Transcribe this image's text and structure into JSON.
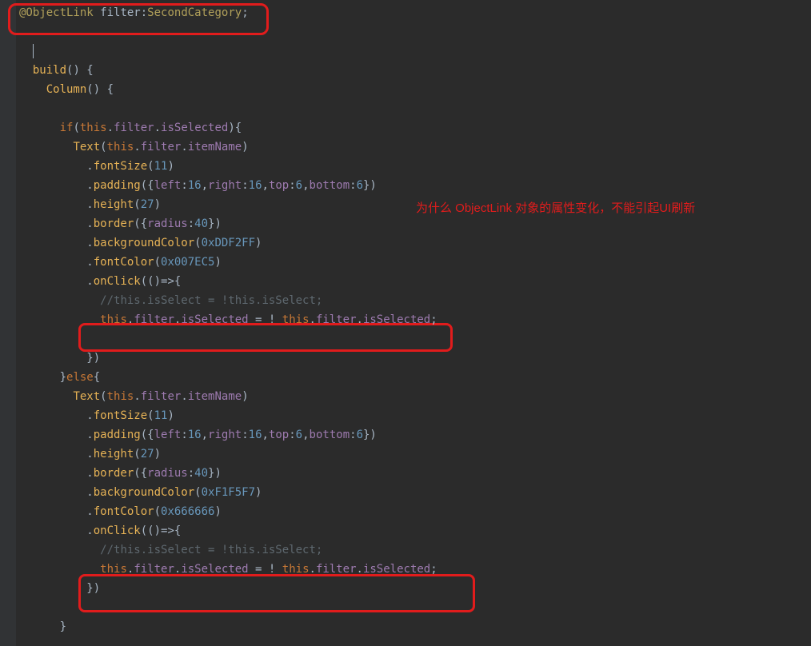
{
  "colors": {
    "bg": "#2b2b2b",
    "gutter": "#313335",
    "fg": "#a9b7c6",
    "annot": "#e11c1c"
  },
  "annotation": "为什么 ObjectLink 对象的属性变化，不能引起UI刷新",
  "lines": {
    "l1a": "@ObjectLink",
    "l1b": " ",
    "l1c": "filter",
    "l1d": ":",
    "l1e": "SecondCategory",
    "l1f": ";",
    "l3": "",
    "l4a": "  ",
    "l4b": "build",
    "l4c": "()",
    " l4d": " {",
    "l5a": "    ",
    "l5b": "Column",
    "l5c": "()",
    " l5d": " {",
    "l7a": "      ",
    "l7b": "if",
    "l7c": "(",
    "l7d": "this",
    "l7e": ".",
    "l7f": "filter",
    "l7g": ".",
    "l7h": "isSelected",
    "l7i": ")",
    "l7j": "{",
    "l8a": "        ",
    "l8b": "Text",
    "l8c": "(",
    "l8d": "this",
    "l8e": ".",
    "l8f": "filter",
    "l8g": ".",
    "l8h": "itemName",
    "l8i": ")",
    "l9a": "          .",
    "l9b": "fontSize",
    "l9c": "(",
    "l9d": "11",
    "l9e": ")",
    "l10a": "          .",
    "l10b": "padding",
    "l10c": "({",
    "l10d": "left",
    "l10e": ":",
    "l10f": "16",
    "l10g": ",",
    "l10h": "right",
    "l10i": ":",
    "l10j": "16",
    "l10k": ",",
    "l10l": "top",
    "l10m": ":",
    "l10n": "6",
    "l10o": ",",
    "l10p": "bottom",
    "l10q": ":",
    "l10r": "6",
    "l10s": "})",
    "l11a": "          .",
    "l11b": "height",
    "l11c": "(",
    "l11d": "27",
    "l11e": ")",
    "l12a": "          .",
    "l12b": "border",
    "l12c": "({",
    "l12d": "radius",
    "l12e": ":",
    "l12f": "40",
    "l12g": "})",
    "l13a": "          .",
    "l13b": "backgroundColor",
    "l13c": "(",
    "l13d": "0xDDF2FF",
    "l13e": ")",
    "l14a": "          .",
    "l14b": "fontColor",
    "l14c": "(",
    "l14d": "0x007EC5",
    "l14e": ")",
    "l15a": "          .",
    "l15b": "onClick",
    "l15c": "(()",
    "l15d": "=>",
    "l15e": "{",
    "l16a": "            ",
    "l16b": "//this.isSelect = !this.isSelect;",
    "l17a": "            ",
    "l17b": "this",
    "l17c": ".",
    "l17d": "filter",
    "l17e": ".",
    "l17f": "isSelected",
    "l17g": " = ! ",
    "l17h": "this",
    "l17i": ".",
    "l17j": "filter",
    "l17k": ".",
    "l17l": "isSelected",
    "l17m": ";",
    "l19a": "          ",
    "l19b": "})",
    "l20a": "      ",
    "l20b": "}",
    "l20c": "else",
    "l20d": "{",
    "l21a": "        ",
    "l21b": "Text",
    "l21c": "(",
    "l21d": "this",
    "l21e": ".",
    "l21f": "filter",
    "l21g": ".",
    "l21h": "itemName",
    "l21i": ")",
    "l22a": "          .",
    "l22b": "fontSize",
    "l22c": "(",
    "l22d": "11",
    "l22e": ")",
    "l23a": "          .",
    "l23b": "padding",
    "l23c": "({",
    "l23d": "left",
    "l23e": ":",
    "l23f": "16",
    "l23g": ",",
    "l23h": "right",
    "l23i": ":",
    "l23j": "16",
    "l23k": ",",
    "l23l": "top",
    "l23m": ":",
    "l23n": "6",
    "l23o": ",",
    "l23p": "bottom",
    "l23q": ":",
    "l23r": "6",
    "l23s": "})",
    "l24a": "          .",
    "l24b": "height",
    "l24c": "(",
    "l24d": "27",
    "l24e": ")",
    "l25a": "          .",
    "l25b": "border",
    "l25c": "({",
    "l25d": "radius",
    "l25e": ":",
    "l25f": "40",
    "l25g": "})",
    "l26a": "          .",
    "l26b": "backgroundColor",
    "l26c": "(",
    "l26d": "0xF1F5F7",
    "l26e": ")",
    "l27a": "          .",
    "l27b": "fontColor",
    "l27c": "(",
    "l27d": "0x666666",
    "l27e": ")",
    "l28a": "          .",
    "l28b": "onClick",
    "l28c": "(()",
    "l28d": "=>",
    "l28e": "{",
    "l29a": "            ",
    "l29b": "//this.isSelect = !this.isSelect;",
    "l30a": "            ",
    "l30b": "this",
    "l30c": ".",
    "l30d": "filter",
    "l30e": ".",
    "l30f": "isSelected",
    "l30g": " = ! ",
    "l30h": "this",
    "l30i": ".",
    "l30j": "filter",
    "l30k": ".",
    "l30l": "isSelected",
    "l30m": ";",
    "l31a": "          ",
    "l31b": "})",
    "l33a": "      ",
    "l33b": "}"
  }
}
